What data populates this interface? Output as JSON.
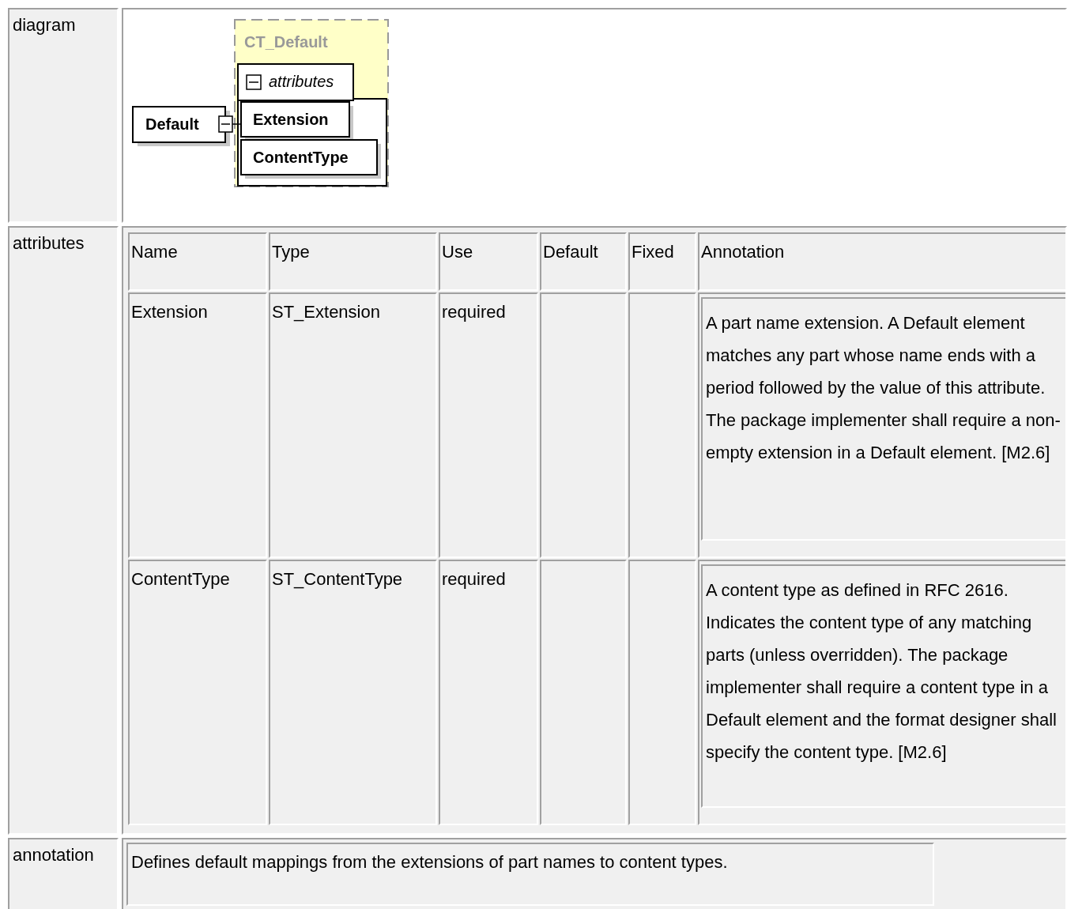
{
  "sections": [
    {
      "kind": "diagram",
      "label": "diagram",
      "diagram": {
        "type_name": "CT_Default",
        "element": "Default",
        "group": "attributes",
        "attributes": [
          "Extension",
          "ContentType"
        ]
      }
    },
    {
      "kind": "attributes",
      "label": "attributes",
      "columns": [
        "Name",
        "Type",
        "Use",
        "Default",
        "Fixed",
        "Annotation"
      ],
      "rows": [
        {
          "cells": [
            "Extension",
            "ST_Extension",
            "required",
            "",
            ""
          ],
          "annotation": "A part name extension. A Default element matches any part whose name ends with a period followed by the value of this attribute. The package implementer shall require a non-empty extension in a Default element. [M2.6]"
        },
        {
          "cells": [
            "ContentType",
            "ST_ContentType",
            "required",
            "",
            ""
          ],
          "annotation": "A content type as defined in RFC 2616. Indicates the content type of any matching parts (unless overridden). The package implementer shall require a content type in a Default element and the format designer shall specify the content type. [M2.6]"
        }
      ]
    },
    {
      "kind": "annotation",
      "label": "annotation",
      "text": "Defines default mappings from the extensions of part names to content types."
    }
  ]
}
